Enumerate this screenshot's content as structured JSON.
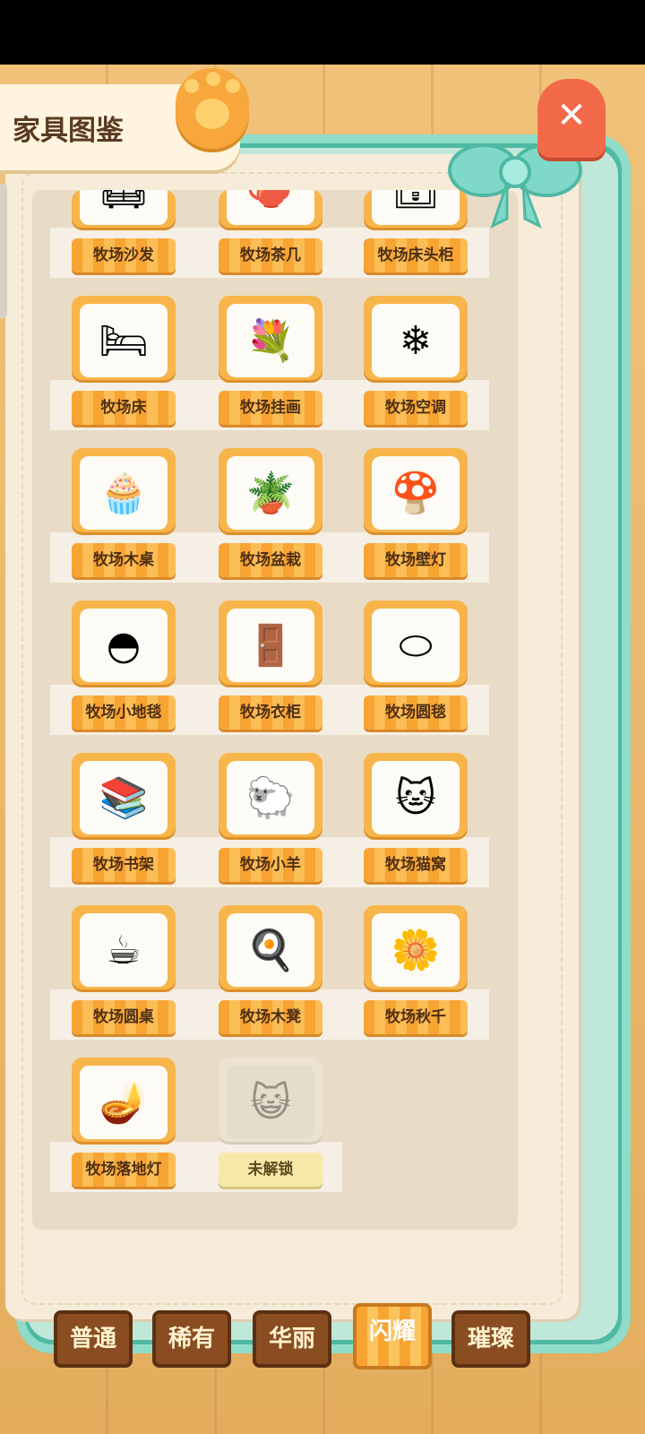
{
  "header": {
    "title": "家具图鉴"
  },
  "icons": {
    "close": "close-icon",
    "paw": "paw-icon",
    "bow": "ribbon-bow-icon",
    "locked": "cat-face-icon"
  },
  "items": [
    {
      "name": "牧场沙发",
      "icon": "sofa-icon",
      "locked": false
    },
    {
      "name": "牧场茶几",
      "icon": "tea-table-icon",
      "locked": false
    },
    {
      "name": "牧场床头柜",
      "icon": "nightstand-icon",
      "locked": false
    },
    {
      "name": "牧场床",
      "icon": "bed-icon",
      "locked": false
    },
    {
      "name": "牧场挂画",
      "icon": "wreath-painting-icon",
      "locked": false
    },
    {
      "name": "牧场空调",
      "icon": "air-conditioner-icon",
      "locked": false
    },
    {
      "name": "牧场木桌",
      "icon": "wooden-desk-icon",
      "locked": false
    },
    {
      "name": "牧场盆栽",
      "icon": "potted-plant-icon",
      "locked": false
    },
    {
      "name": "牧场壁灯",
      "icon": "mushroom-lamp-icon",
      "locked": false
    },
    {
      "name": "牧场小地毯",
      "icon": "small-rug-icon",
      "locked": false
    },
    {
      "name": "牧场衣柜",
      "icon": "wardrobe-icon",
      "locked": false
    },
    {
      "name": "牧场圆毯",
      "icon": "round-rug-icon",
      "locked": false
    },
    {
      "name": "牧场书架",
      "icon": "bookshelf-icon",
      "locked": false
    },
    {
      "name": "牧场小羊",
      "icon": "rocking-sheep-icon",
      "locked": false
    },
    {
      "name": "牧场猫窝",
      "icon": "cat-bed-icon",
      "locked": false
    },
    {
      "name": "牧场圆桌",
      "icon": "round-table-icon",
      "locked": false
    },
    {
      "name": "牧场木凳",
      "icon": "wooden-stool-icon",
      "locked": false
    },
    {
      "name": "牧场秋千",
      "icon": "swing-icon",
      "locked": false
    },
    {
      "name": "牧场落地灯",
      "icon": "floor-lamp-icon",
      "locked": false
    },
    {
      "name": "未解锁",
      "icon": "cat-face-icon",
      "locked": true
    }
  ],
  "tabs": [
    {
      "label": "普通",
      "active": false
    },
    {
      "label": "稀有",
      "active": false
    },
    {
      "label": "华丽",
      "active": false
    },
    {
      "label": "闪耀",
      "active": true
    },
    {
      "label": "璀璨",
      "active": false
    }
  ],
  "colors": {
    "accent": "#f7a433",
    "frame": "#4fb9a3",
    "page": "#f7ecd9",
    "close": "#f26a4a"
  }
}
